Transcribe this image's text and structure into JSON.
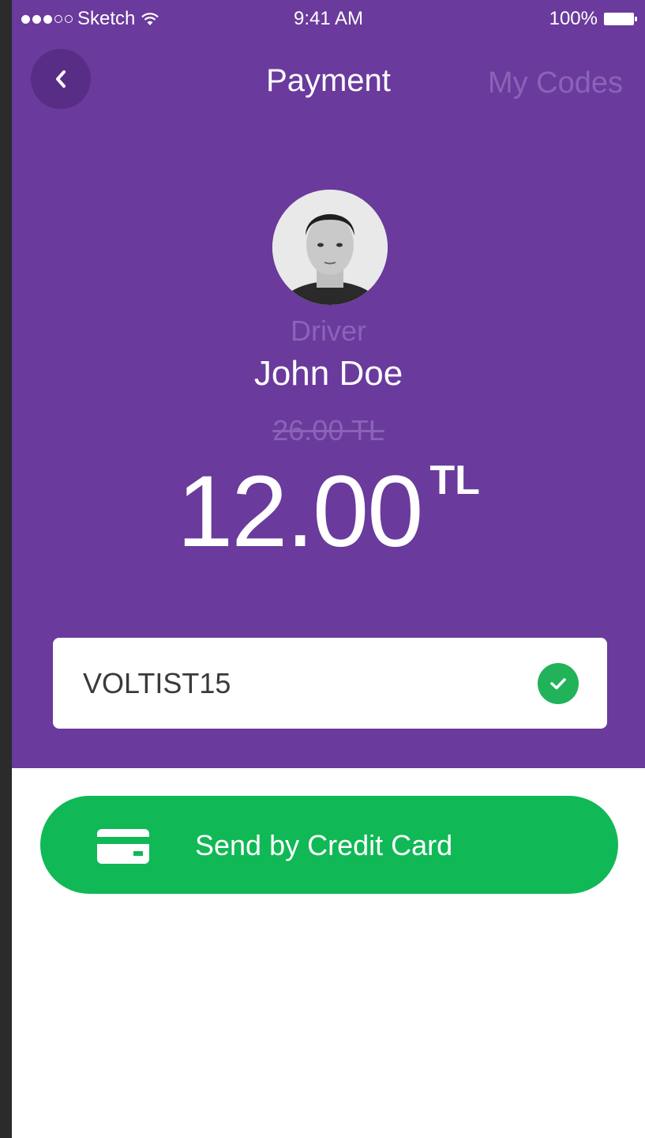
{
  "status_bar": {
    "carrier": "Sketch",
    "time": "9:41 AM",
    "battery": "100%"
  },
  "nav": {
    "title": "Payment",
    "right_link": "My Codes"
  },
  "driver": {
    "label": "Driver",
    "name": "John Doe"
  },
  "price": {
    "original": "26.00 TL",
    "discounted": "12.00",
    "currency": "TL"
  },
  "promo": {
    "code": "VOLTIST15"
  },
  "action": {
    "label": "Send by Credit Card"
  },
  "colors": {
    "purple": "#6a3a9c",
    "green": "#11b856",
    "muted_purple": "#8a63b8"
  }
}
